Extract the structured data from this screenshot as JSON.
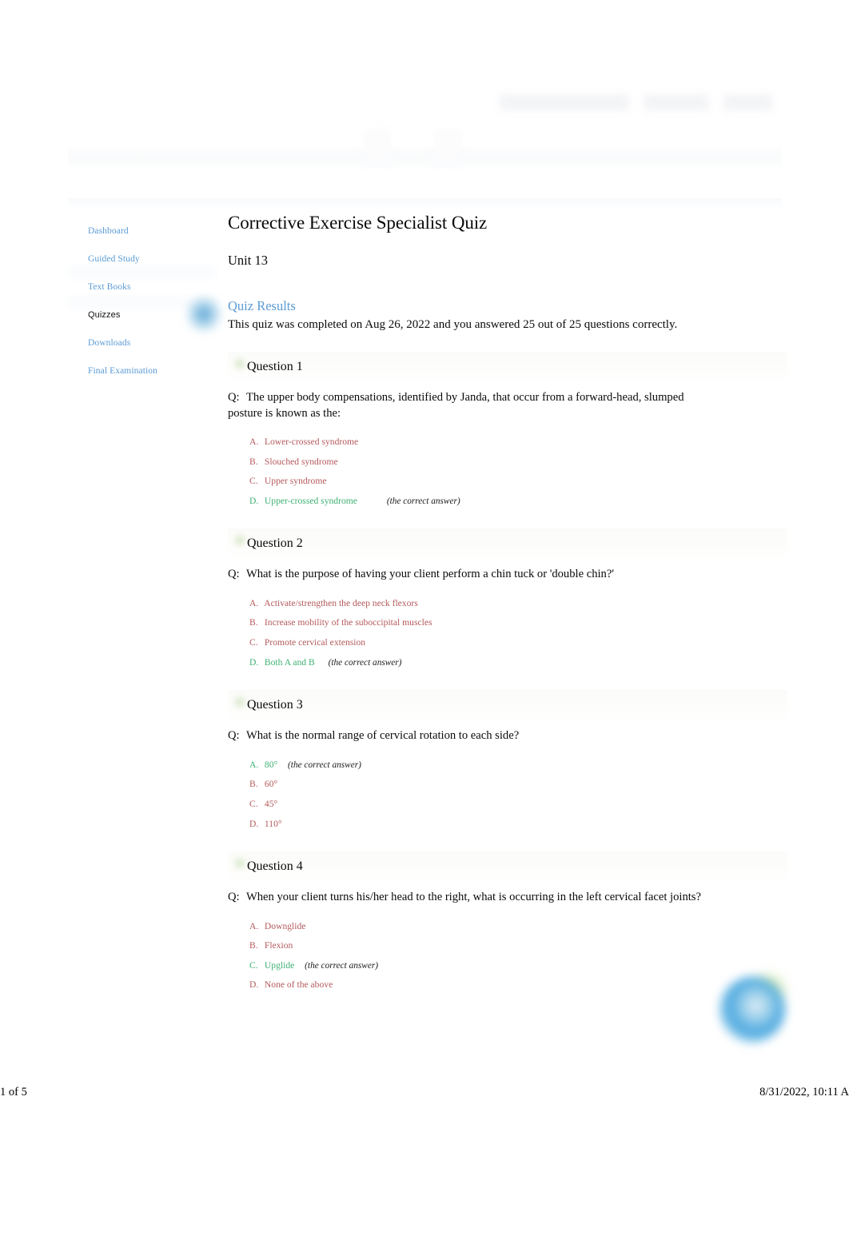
{
  "header": {
    "nav_ghost_items": [
      "",
      "",
      ""
    ],
    "mid_ghost_items": [
      "",
      ""
    ]
  },
  "sidebar": {
    "items": [
      {
        "label": "Dashboard",
        "active": false
      },
      {
        "label": "Guided Study",
        "active": false
      },
      {
        "label": "Text Books",
        "active": false
      },
      {
        "label": "Quizzes",
        "active": true
      },
      {
        "label": "Downloads",
        "active": false
      },
      {
        "label": "Final Examination",
        "active": false
      }
    ]
  },
  "main": {
    "page_title": "Corrective Exercise Specialist Quiz",
    "unit_label": "Unit 13",
    "results_heading": "Quiz Results",
    "results_text": "This quiz was completed on Aug 26, 2022 and you answered 25 out of 25 questions correctly.",
    "correct_note": "(the correct answer)",
    "q_prefix": "Q:",
    "questions": [
      {
        "title": "Question 1",
        "prompt": "The upper body compensations, identified by Janda, that occur from a forward-head, slumped posture is known as the:",
        "answers": [
          {
            "letter": "A.",
            "text": "Lower-crossed syndrome",
            "correct": false
          },
          {
            "letter": "B.",
            "text": "Slouched syndrome",
            "correct": false
          },
          {
            "letter": "C.",
            "text": "Upper syndrome",
            "correct": false
          },
          {
            "letter": "D.",
            "text": "Upper-crossed syndrome",
            "correct": true
          }
        ]
      },
      {
        "title": "Question 2",
        "prompt": "What is the purpose of having your client perform a chin tuck or 'double chin?'",
        "answers": [
          {
            "letter": "A.",
            "text": "Activate/strengthen the deep neck flexors",
            "correct": false
          },
          {
            "letter": "B.",
            "text": "Increase mobility of the suboccipital muscles",
            "correct": false
          },
          {
            "letter": "C.",
            "text": "Promote cervical extension",
            "correct": false
          },
          {
            "letter": "D.",
            "text": "Both A and B",
            "correct": true
          }
        ]
      },
      {
        "title": "Question 3",
        "prompt": "What is the normal range of cervical rotation to each side?",
        "answers": [
          {
            "letter": "A.",
            "text": "80°",
            "correct": true
          },
          {
            "letter": "B.",
            "text": "60°",
            "correct": false
          },
          {
            "letter": "C.",
            "text": "45°",
            "correct": false
          },
          {
            "letter": "D.",
            "text": "110°",
            "correct": false
          }
        ]
      },
      {
        "title": "Question 4",
        "prompt": "When your client turns his/her head to the right, what is occurring in the left cervical facet joints?",
        "answers": [
          {
            "letter": "A.",
            "text": "Downglide",
            "correct": false
          },
          {
            "letter": "B.",
            "text": "Flexion",
            "correct": false
          },
          {
            "letter": "C.",
            "text": "Upglide",
            "correct": true
          },
          {
            "letter": "D.",
            "text": "None of the above",
            "correct": false
          }
        ]
      }
    ]
  },
  "footer": {
    "page_indicator": "1 of 5",
    "timestamp": "8/31/2022, 10:11 A"
  },
  "colors": {
    "link_blue": "#5b9bd5",
    "wrong_red": "#b5595b",
    "correct_green": "#3fb173",
    "text_black": "#0a0a0a"
  }
}
